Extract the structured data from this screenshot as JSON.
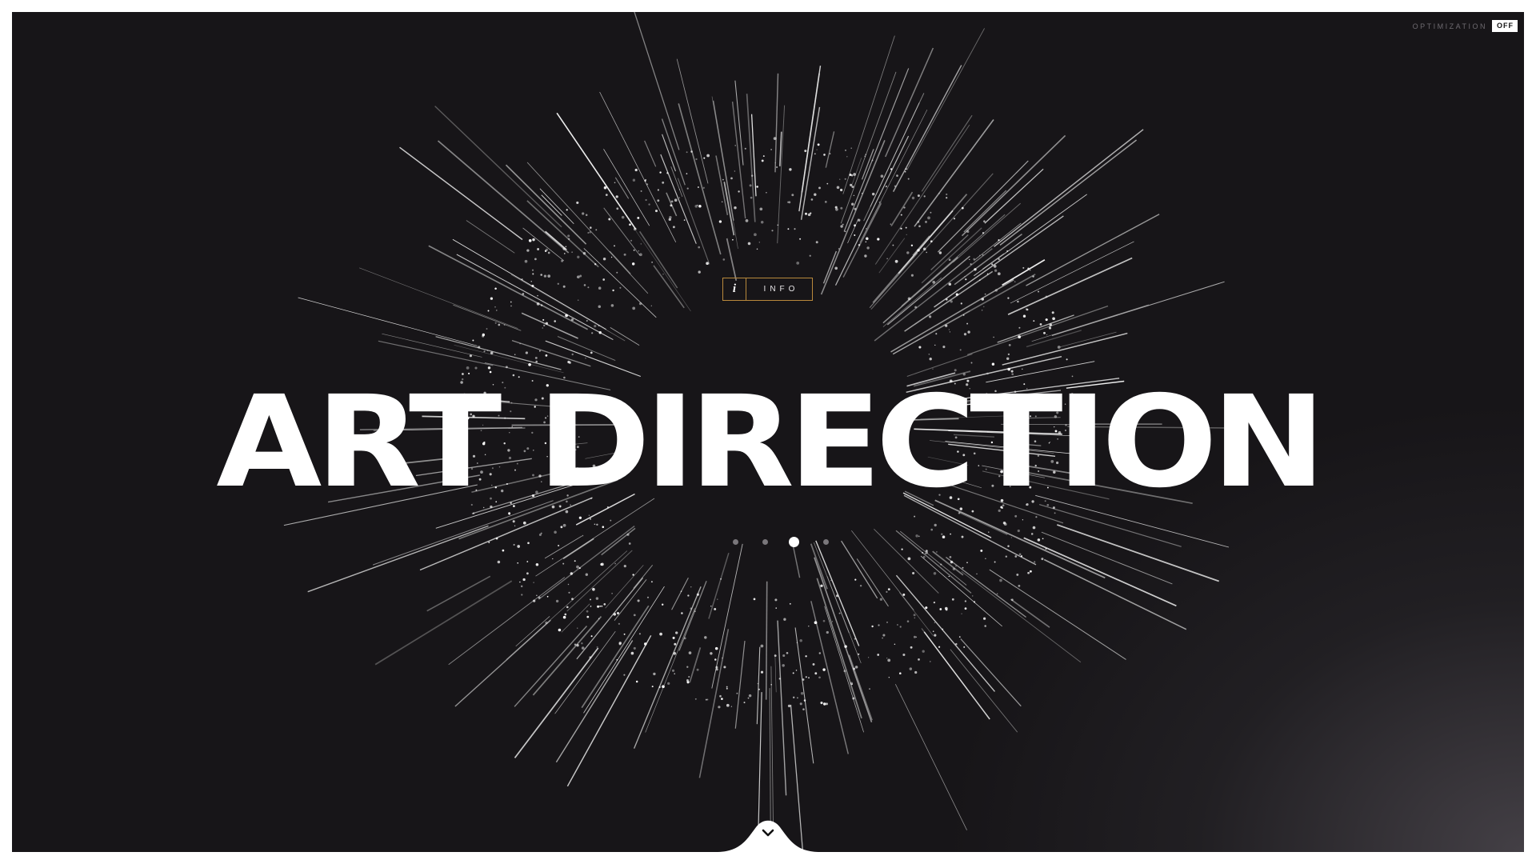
{
  "optimization": {
    "label": "OPTIMIZATION",
    "state": "OFF"
  },
  "info_button": {
    "icon": "i",
    "label": "INFO"
  },
  "headline": "ART DIRECTION",
  "pager": {
    "count": 4,
    "active_index": 2
  },
  "scroll_down": {
    "icon": "chevron-down-icon"
  },
  "colors": {
    "background": "#171518",
    "accent": "#b9893c",
    "text": "#ffffff"
  }
}
